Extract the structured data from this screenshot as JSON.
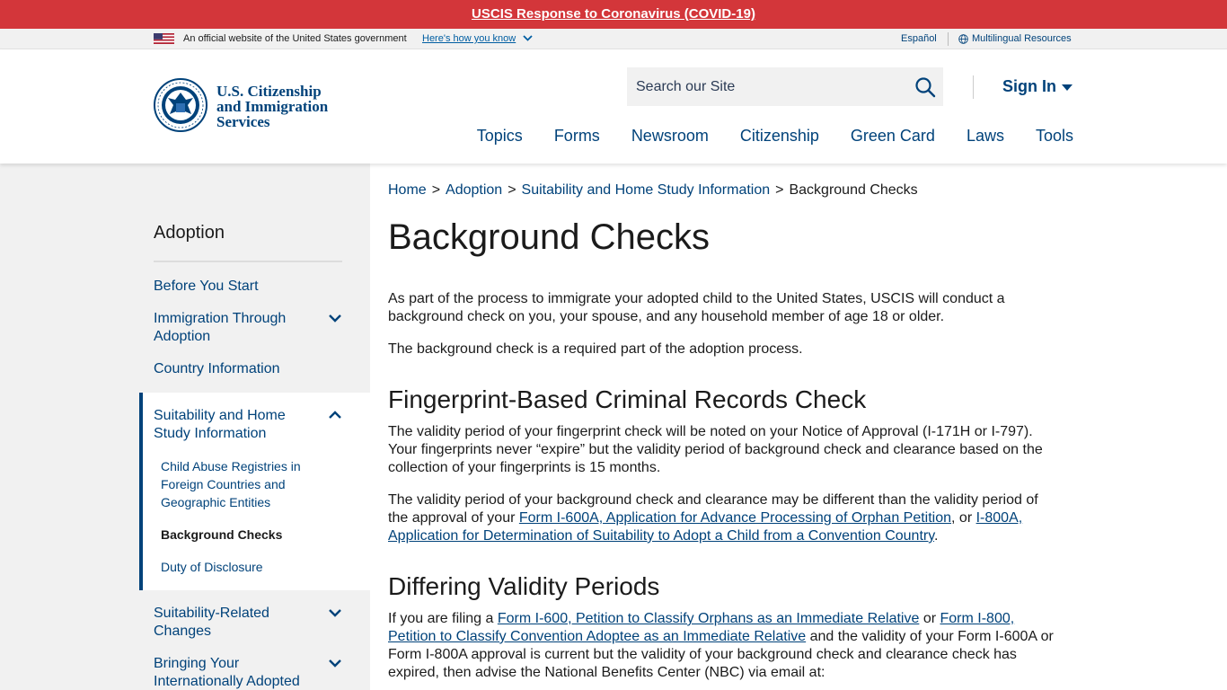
{
  "alert": {
    "text": "USCIS Response to Coronavirus (COVID-19)"
  },
  "gov_banner": {
    "official_text": "An official website of the United States government",
    "how_link": "Here's how you know",
    "espanol": "Español",
    "multilingual": "Multilingual Resources"
  },
  "header": {
    "logo_line1": "U.S. Citizenship",
    "logo_line2": "and Immigration",
    "logo_line3": "Services",
    "search_placeholder": "Search our Site",
    "signin": "Sign In",
    "nav": [
      "Topics",
      "Forms",
      "Newsroom",
      "Citizenship",
      "Green Card",
      "Laws",
      "Tools"
    ]
  },
  "sidebar": {
    "title": "Adoption",
    "items": [
      {
        "label": "Before You Start"
      },
      {
        "label": "Immigration Through Adoption"
      },
      {
        "label": "Country Information"
      },
      {
        "label": "Suitability and Home Study Information"
      },
      {
        "label": "Suitability-Related Changes"
      },
      {
        "label": "Bringing Your Internationally Adopted"
      }
    ],
    "sub_items": [
      {
        "label": "Child Abuse Registries in Foreign Countries and Geographic Entities"
      },
      {
        "label": "Background Checks"
      },
      {
        "label": "Duty of Disclosure"
      }
    ]
  },
  "breadcrumb": {
    "home": "Home",
    "adoption": "Adoption",
    "suitability": "Suitability and Home Study Information",
    "current": "Background Checks"
  },
  "main": {
    "title": "Background Checks",
    "intro_p1": "As part of the process to immigrate your adopted child to the United States, USCIS will conduct a background check on you, your spouse, and any household member of age 18 or older.",
    "intro_p2": "The background check is a required part of the adoption process.",
    "h2_fingerprint": "Fingerprint-Based Criminal Records Check",
    "fp_p1": "The validity period of your fingerprint check will be noted on your Notice of Approval (I-171H or I-797). Your fingerprints never “expire” but the validity period of background check and clearance based on the collection of your fingerprints is 15 months.",
    "fp_p2_a": "The validity period of your background check and clearance may be different than the validity period of the approval of your ",
    "fp_p2_link1": "Form I-600A, Application for Advance Processing of Orphan Petition",
    "fp_p2_b": ", or ",
    "fp_p2_link2": "I-800A, Application for Determination of Suitability to Adopt a Child from a Convention Country",
    "fp_p2_c": ".",
    "h2_differing": "Differing Validity Periods",
    "dv_p1_a": "If you are filing a ",
    "dv_p1_link1": "Form I-600, Petition to Classify Orphans as an Immediate Relative",
    "dv_p1_b": " or ",
    "dv_p1_link2": "Form I-800, Petition to Classify Convention Adoptee as an Immediate Relative",
    "dv_p1_c": " and the validity of your Form I-600A or Form I-800A approval is current but the validity of your background check and clearance check has expired, then advise the National Benefits Center (NBC) via email at:"
  },
  "colors": {
    "alert_red": "#d3363a",
    "brand_blue": "#00427a",
    "sidebar_bg": "#f1f1f1"
  },
  "icons": [
    "us-flag-icon",
    "chevron-down-icon",
    "globe-icon",
    "dhs-seal-icon",
    "search-icon",
    "caret-down-icon",
    "chevron-up-icon"
  ]
}
